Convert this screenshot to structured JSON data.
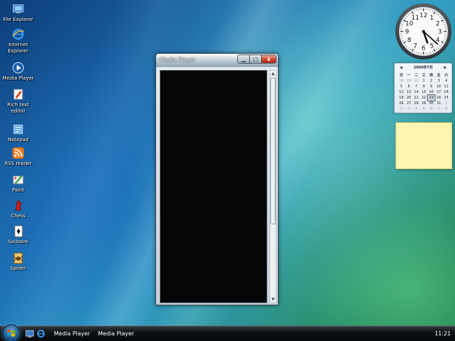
{
  "desktop": {
    "icons": [
      {
        "label": "File Explorer",
        "icon": "file-explorer-icon"
      },
      {
        "label": "Internet Explorer",
        "icon": "internet-explorer-icon"
      },
      {
        "label": "Media Player",
        "icon": "media-player-icon"
      },
      {
        "label": "Rich text editor",
        "icon": "rich-text-editor-icon"
      },
      {
        "label": "Notepad",
        "icon": "notepad-icon"
      },
      {
        "label": "RSS reader",
        "icon": "rss-reader-icon"
      },
      {
        "label": "Paint",
        "icon": "paint-icon"
      },
      {
        "label": "Chess",
        "icon": "chess-icon"
      },
      {
        "label": "Solitaire",
        "icon": "solitaire-icon"
      },
      {
        "label": "Spider",
        "icon": "spider-icon"
      }
    ]
  },
  "window": {
    "title": "Media Player",
    "min_glyph": "▁",
    "max_glyph": "□",
    "close_glyph": "x",
    "scroll_up": "▲",
    "scroll_down": "▼"
  },
  "clock": {
    "numbers": [
      "12",
      "1",
      "2",
      "3",
      "4",
      "5",
      "6",
      "7",
      "8",
      "9",
      "10",
      "11"
    ],
    "hour_hand_to": 5,
    "minute_hand_to": 22
  },
  "calendar": {
    "month": "2009年7月",
    "prev": "◀",
    "next": "▶",
    "weekdays": [
      "日",
      "一",
      "二",
      "三",
      "四",
      "五",
      "六"
    ],
    "weeks": [
      [
        "28",
        "29",
        "30",
        "1",
        "2",
        "3",
        "4"
      ],
      [
        "5",
        "6",
        "7",
        "8",
        "9",
        "10",
        "11"
      ],
      [
        "12",
        "13",
        "14",
        "15",
        "16",
        "17",
        "18"
      ],
      [
        "19",
        "20",
        "21",
        "22",
        "23",
        "24",
        "25"
      ],
      [
        "26",
        "27",
        "28",
        "29",
        "30",
        "31",
        "1"
      ],
      [
        "2",
        "3",
        "4",
        "5",
        "6",
        "7",
        "8"
      ]
    ],
    "today": "23"
  },
  "taskbar": {
    "tasks": [
      "Media Player",
      "Media Player"
    ],
    "time": "11:21"
  }
}
